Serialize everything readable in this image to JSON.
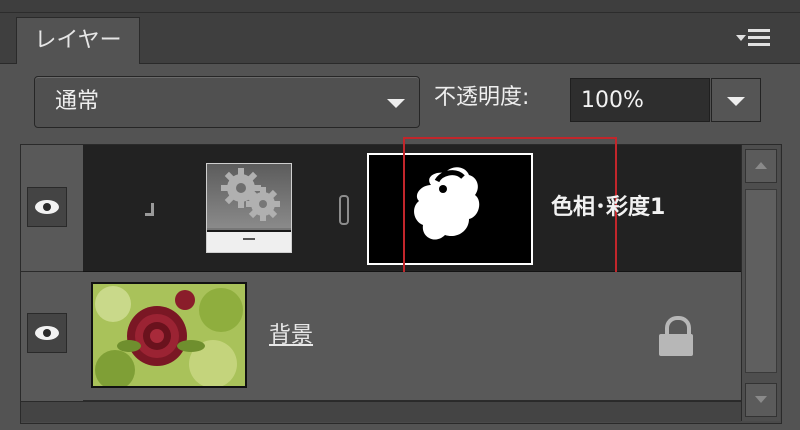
{
  "panel": {
    "tab_label": "レイヤー",
    "menu_icon": "panel-menu-icon"
  },
  "controls": {
    "blend_mode": "通常",
    "opacity_label": "不透明度:",
    "opacity_value": "100%"
  },
  "layers": [
    {
      "name": "色相･彩度1",
      "visible": true,
      "type": "adjustment",
      "icon": "gears-icon",
      "has_mask": true,
      "clipped": true
    },
    {
      "name": "背景",
      "visible": true,
      "type": "image",
      "locked": true
    }
  ],
  "colors": {
    "panel_bg": "#535353",
    "selected_row": "#222222",
    "highlight": "#c2262b"
  }
}
